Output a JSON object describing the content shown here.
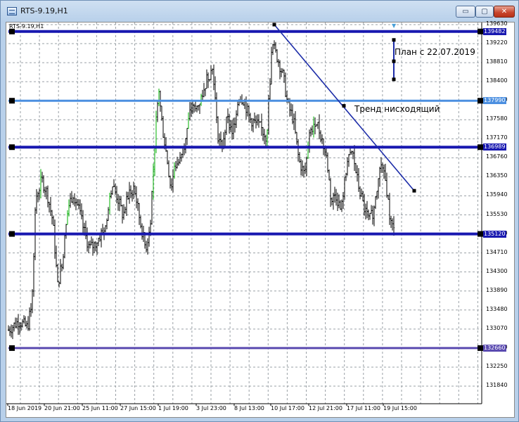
{
  "window": {
    "title": "RTS-9.19,H1",
    "minimize_glyph": "▭",
    "maximize_glyph": "▢",
    "close_glyph": "✕"
  },
  "chart": {
    "symbol_label": "RTS-9.19,H1",
    "colors": {
      "grid": "#9aa0a6",
      "bars": "#000000",
      "bull_bars": "#00b000",
      "level_dark": "#1818b0",
      "level_light": "#4b8fe0",
      "level_purple": "#5a4ab0",
      "trend": "#1c2ca8"
    },
    "price_ticks": [
      "139630",
      "139220",
      "138810",
      "138400",
      "137990",
      "137580",
      "137170",
      "136760",
      "136350",
      "135940",
      "135530",
      "135120",
      "134710",
      "134300",
      "133890",
      "133480",
      "133070",
      "132660",
      "132250",
      "131840"
    ],
    "date_ticks": [
      "18 Jun 2019",
      "20 Jun 21:00",
      "25 Jun 11:00",
      "27 Jun 15:00",
      "1 Jul 19:00",
      "3 Jul 23:00",
      "8 Jul 13:00",
      "10 Jul 17:00",
      "12 Jul 21:00",
      "17 Jul 11:00",
      "19 Jul 15:00"
    ],
    "horizontal_levels": [
      {
        "price": 139482,
        "label": "139482",
        "style": "dark"
      },
      {
        "price": 137990,
        "label": "137990",
        "style": "light"
      },
      {
        "price": 136989,
        "label": "136989",
        "style": "dark"
      },
      {
        "price": 135120,
        "label": "135120",
        "style": "dark"
      },
      {
        "price": 132660,
        "label": "132660",
        "style": "purple"
      }
    ],
    "annotations": {
      "plan": "План с 22.07.2019",
      "trend": "Тренд нисходящий"
    },
    "scroll_marker": "▼"
  }
}
